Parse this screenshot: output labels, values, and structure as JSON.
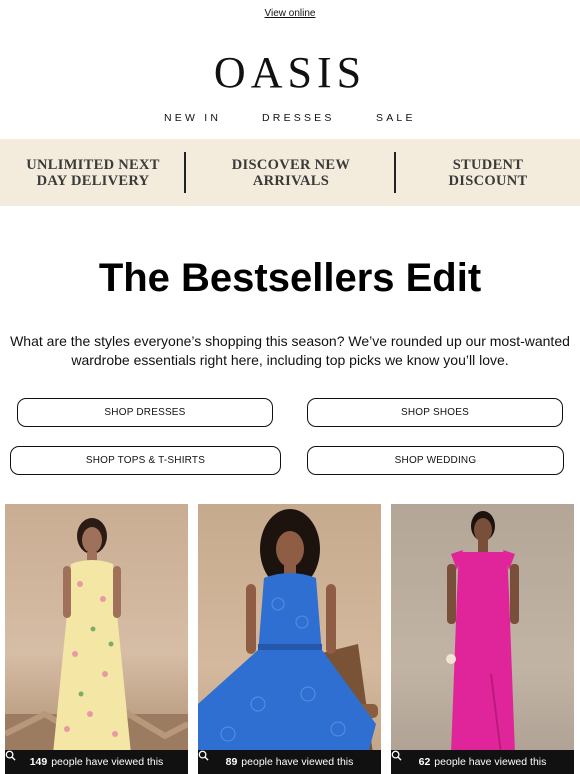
{
  "header": {
    "view_online": "View online",
    "logo": "OASIS"
  },
  "nav": {
    "items": [
      "NEW IN",
      "DRESSES",
      "SALE"
    ]
  },
  "banner": {
    "items": [
      {
        "line1": "UNLIMITED NEXT",
        "line2": "DAY DELIVERY"
      },
      {
        "line1": "DISCOVER NEW",
        "line2": "ARRIVALS"
      },
      {
        "line1": "STUDENT",
        "line2": "DISCOUNT"
      }
    ]
  },
  "hero": {
    "title": "The Bestsellers Edit",
    "intro_line1": "What are the styles everyone’s shopping this season? We’ve rounded up our most-wanted",
    "intro_line2": "wardrobe essentials right here, including top picks we know you’ll love."
  },
  "buttons": [
    "SHOP DRESSES",
    "SHOP SHOES",
    "SHOP TOPS & T-SHIRTS",
    "SHOP WEDDING"
  ],
  "products": [
    {
      "count": "149",
      "suffix": "people have viewed this",
      "image": "yellow floral tiered maxi dress"
    },
    {
      "count": "89",
      "suffix": "people have viewed this",
      "image": "blue lace sleeveless midi dress"
    },
    {
      "count": "62",
      "suffix": "people have viewed this",
      "image": "pink satin tie-shoulder maxi dress"
    }
  ],
  "colors": {
    "banner_bg": "#f3ecdc",
    "viewed_bar": "#111111",
    "dress_yellow": "#f4e7a6",
    "dress_blue": "#2f6fd1",
    "dress_pink": "#e0259a"
  }
}
